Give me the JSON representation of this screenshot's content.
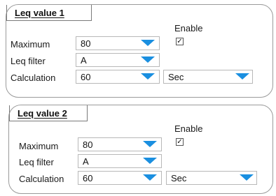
{
  "panels": [
    {
      "title": "Leq value 1",
      "enable_label": "Enable",
      "enable_checked": true,
      "maximum_label": "Maximum",
      "maximum_value": "80",
      "filter_label": "Leq filter",
      "filter_value": "A",
      "calc_label": "Calculation",
      "calc_value": "60",
      "unit_value": "Sec"
    },
    {
      "title": "Leq value 2",
      "enable_label": "Enable",
      "enable_checked": true,
      "maximum_label": "Maximum",
      "maximum_value": "80",
      "filter_label": "Leq filter",
      "filter_value": "A",
      "calc_label": "Calculation",
      "calc_value": "60",
      "unit_value": "Sec"
    }
  ],
  "colors": {
    "dropdown_arrow": "#1a8fe0",
    "panel_border": "#9a9a9a"
  }
}
